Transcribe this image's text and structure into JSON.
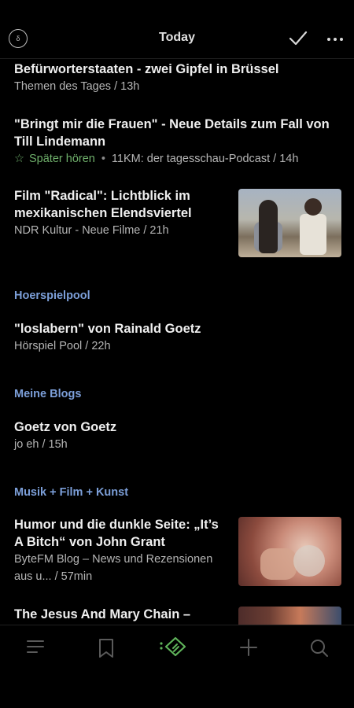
{
  "header": {
    "title": "Today",
    "logo_text": "δ",
    "check_icon": "check-icon",
    "more_icon": "more-icon"
  },
  "articles": [
    {
      "headline": "Befürworterstaaten - zwei Gipfel in Brüssel",
      "meta": "Themen des Tages / 13h"
    },
    {
      "headline_line1": "\"Bringt mir die Frauen\" - Neue Details zum Fall von",
      "headline_line2": "Till Lindemann",
      "later_label": "Später hören",
      "meta": "11KM: der tagesschau-Podcast / 14h"
    },
    {
      "headline_line1": "Film \"Radical\": Lichtblick im",
      "headline_line2": "mexikanischen Elendsviertel",
      "meta": "NDR Kultur - Neue Filme / 21h"
    }
  ],
  "sections": [
    {
      "label": "Hoerspielpool",
      "items": [
        {
          "headline": "\"loslabern\" von Rainald Goetz",
          "meta": "Hörspiel Pool / 22h"
        }
      ]
    },
    {
      "label": "Meine Blogs",
      "items": [
        {
          "headline": "Goetz von Goetz",
          "meta": "jo eh / 15h"
        }
      ]
    },
    {
      "label": "Musik + Film + Kunst",
      "items": [
        {
          "headline_line1": "Humor und die dunkle Seite: „It’s",
          "headline_line2": "A Bitch“ von John Grant",
          "meta_line1": "ByteFM Blog – News und Rezensionen",
          "meta_line2": "aus u... / 57min"
        },
        {
          "headline": "The Jesus And Mary Chain –"
        }
      ]
    }
  ],
  "tabbar": {
    "items": [
      "menu-icon",
      "bookmark-icon",
      "feedly-icon",
      "add-icon",
      "search-icon"
    ]
  },
  "colors": {
    "background": "#000000",
    "section_accent": "#7c9fd9",
    "read_later_green": "#6fb06b"
  }
}
